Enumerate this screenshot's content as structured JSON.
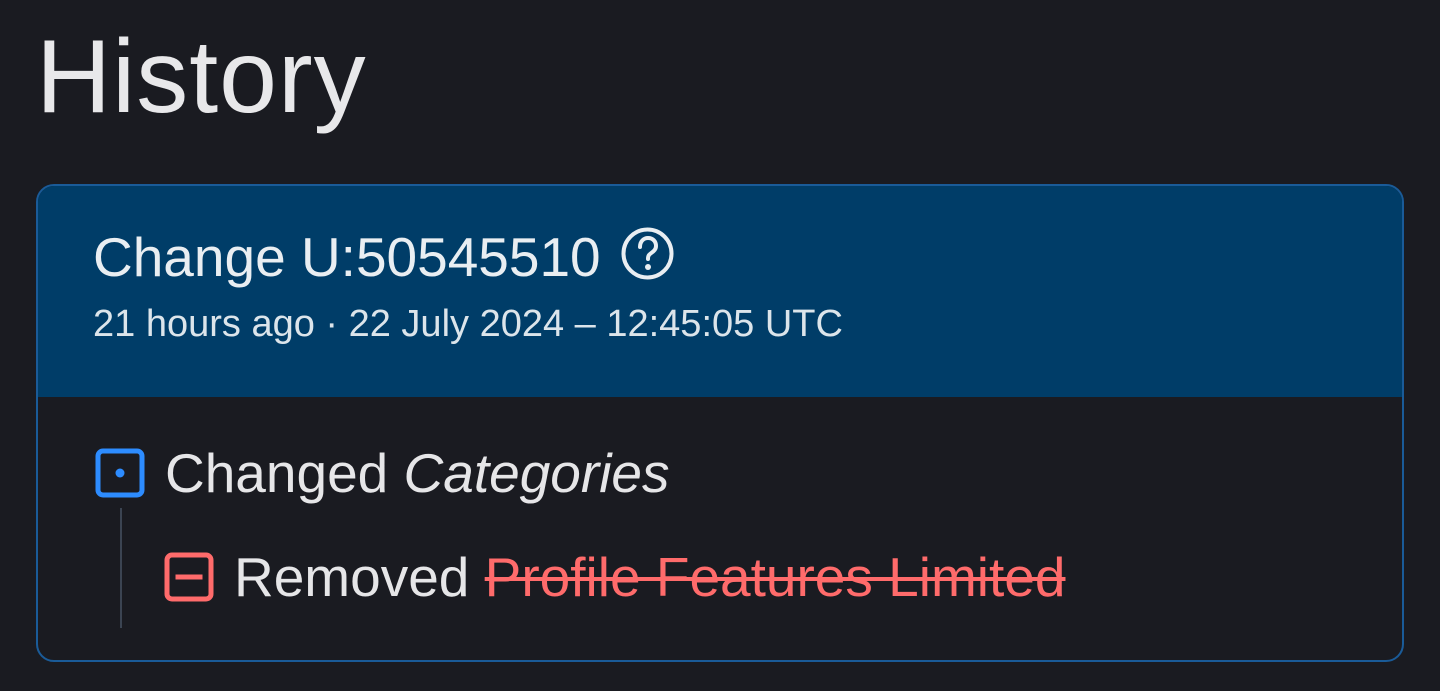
{
  "page": {
    "title": "History"
  },
  "change": {
    "title": "Change U:50545510",
    "help_icon": "question-circle-icon",
    "timestamp": "21 hours ago · 22 July 2024 – 12:45:05 UTC"
  },
  "items": [
    {
      "verb": "Changed",
      "target": "Categories",
      "icon": "category-change-icon",
      "color": "#2d8cff"
    },
    {
      "verb": "Removed",
      "target": "Profile Features Limited",
      "icon": "remove-icon",
      "color": "#ff6b6b"
    }
  ],
  "colors": {
    "background": "#1a1b21",
    "header": "#003d68",
    "border": "#1a5b98",
    "accent_blue": "#2d8cff",
    "accent_red": "#ff6b6b"
  }
}
